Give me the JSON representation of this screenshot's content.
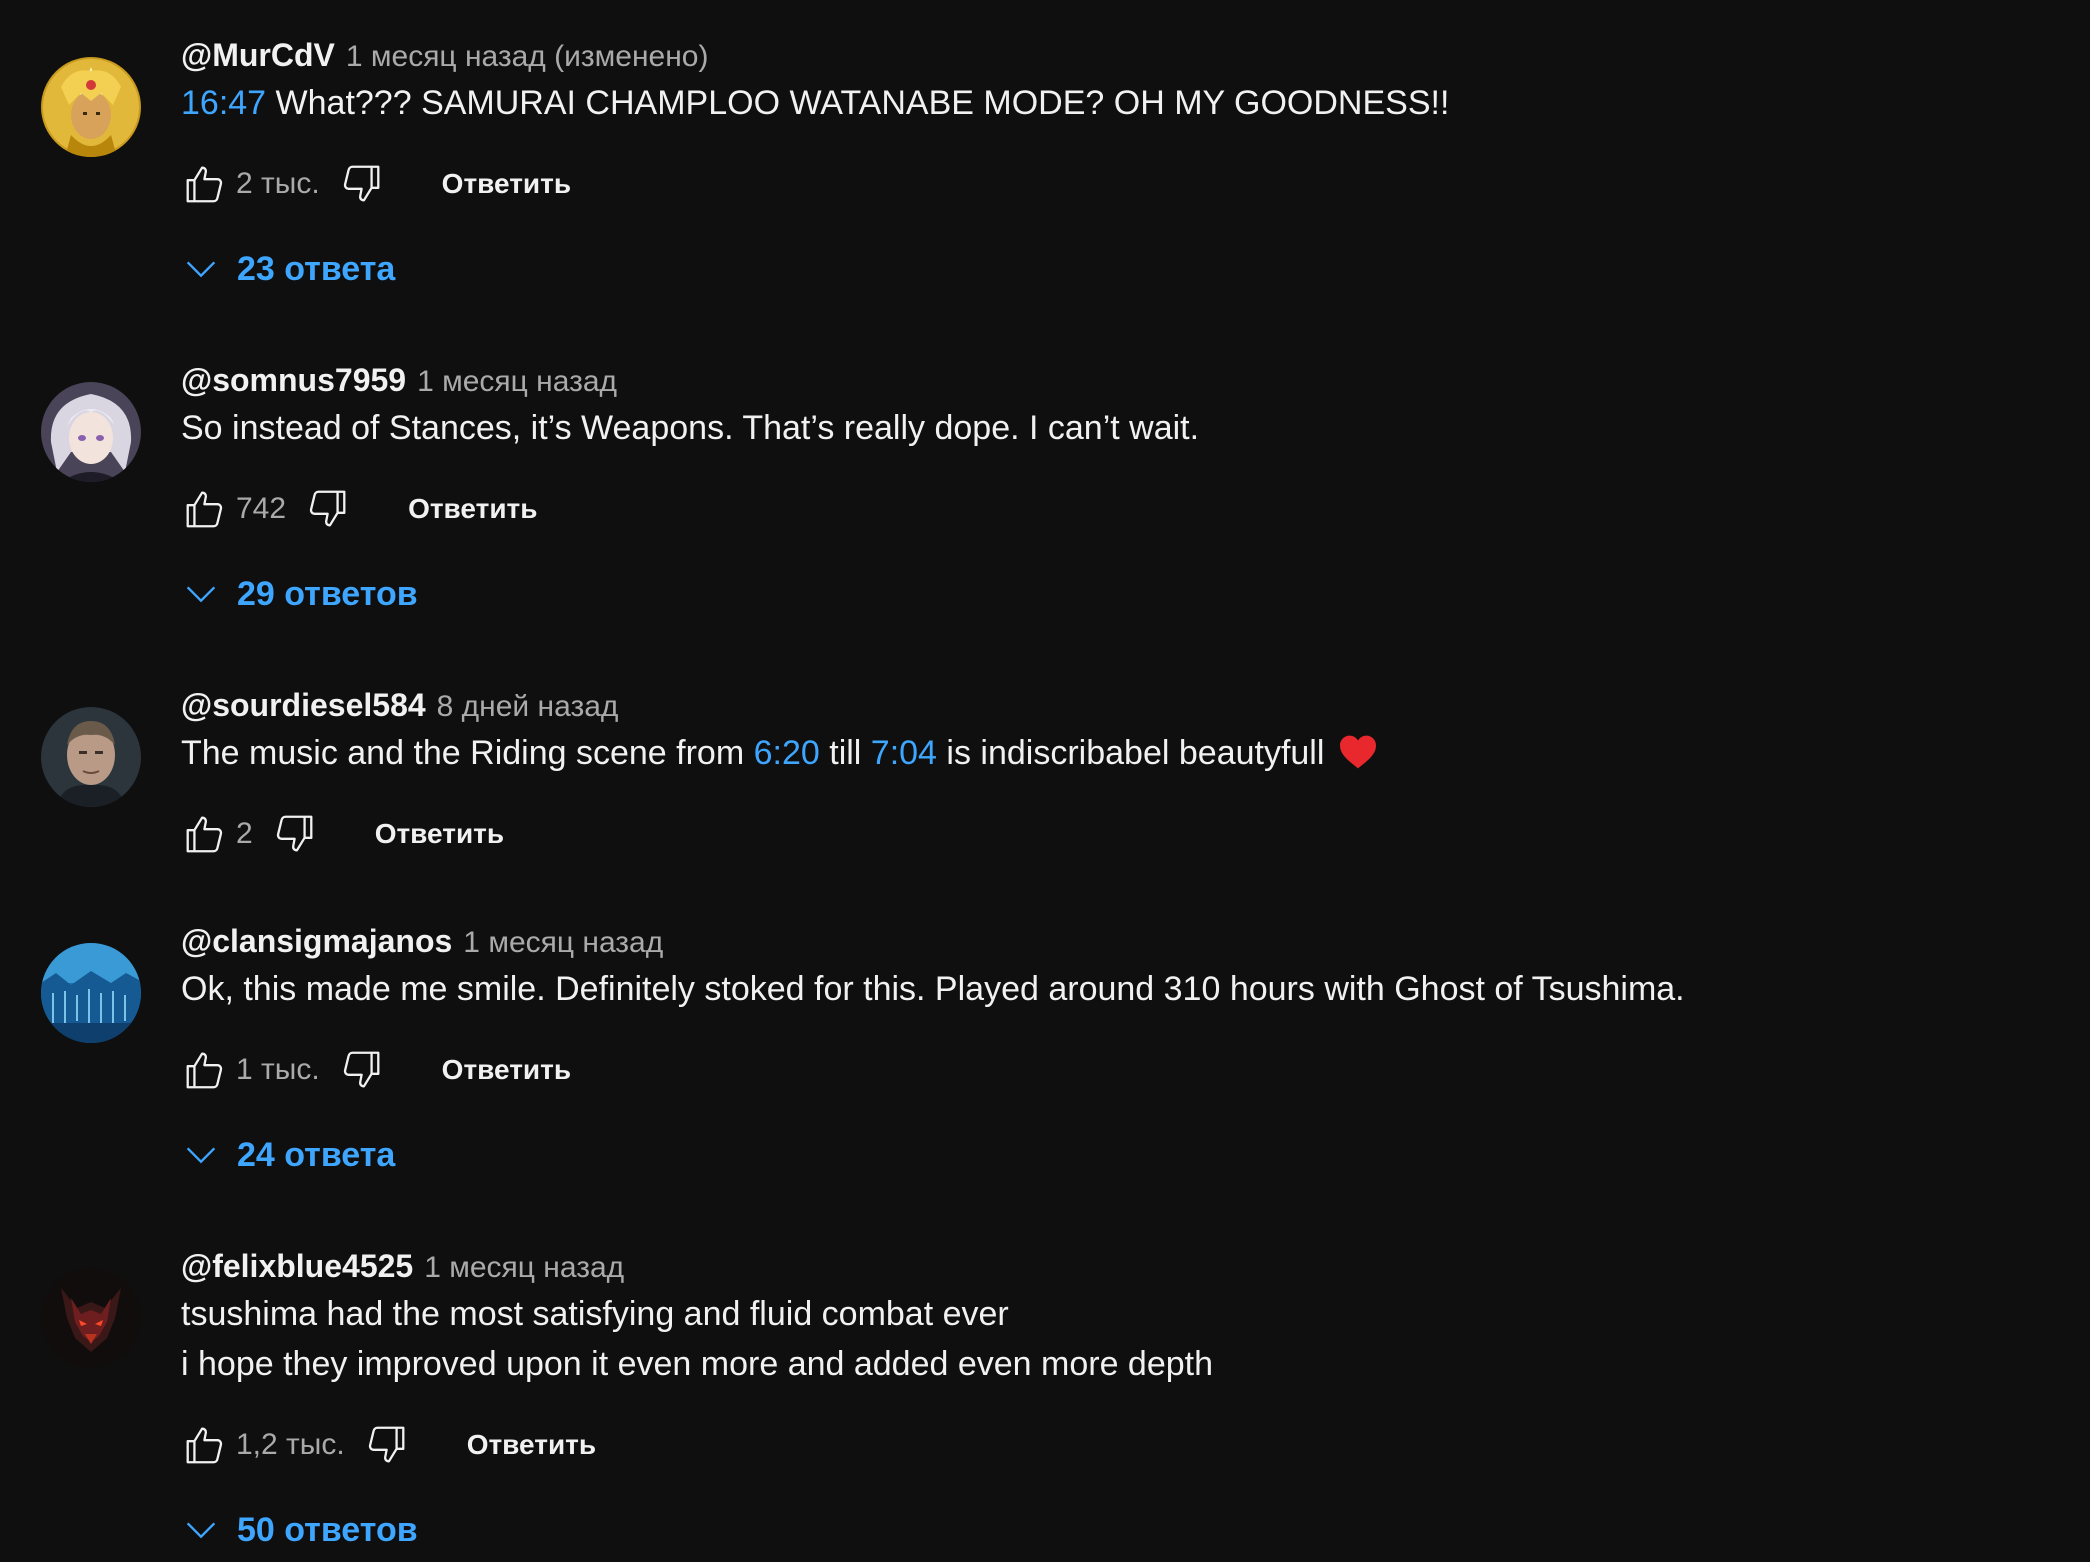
{
  "colors": {
    "background": "#0f0f0f",
    "text_primary": "#f1f1f1",
    "text_secondary": "#aaaaaa",
    "link": "#3ea6ff"
  },
  "comments": [
    {
      "author": "@MurCdV",
      "time": "1 месяц назад (изменено)",
      "text_parts": [
        {
          "text": "16:47",
          "timestamp": true
        },
        {
          "text": " What??? SAMURAI CHAMPLOO WATANABE MODE? OH MY GOODNESS!!",
          "timestamp": false
        }
      ],
      "likes": "2 тыс.",
      "reply_label": "Ответить",
      "replies_label": "23 ответа",
      "avatar_icon": "golden-warrior-avatar"
    },
    {
      "author": "@somnus7959",
      "time": "1 месяц назад",
      "text_parts": [
        {
          "text": "So instead of Stances, it’s Weapons. That’s really dope. I can’t wait.",
          "timestamp": false
        }
      ],
      "likes": "742",
      "reply_label": "Ответить",
      "replies_label": "29 ответов",
      "avatar_icon": "silver-hair-anime-avatar"
    },
    {
      "author": "@sourdiesel584",
      "time": "8 дней назад",
      "text_parts": [
        {
          "text": "The music and the Riding scene from ",
          "timestamp": false
        },
        {
          "text": "6:20",
          "timestamp": true
        },
        {
          "text": " till ",
          "timestamp": false
        },
        {
          "text": "7:04",
          "timestamp": true
        },
        {
          "text": " is indiscribabel beautyfull",
          "timestamp": false
        }
      ],
      "emoji": "heart-emoji",
      "likes": "2",
      "reply_label": "Ответить",
      "replies_label": "",
      "avatar_icon": "man-portrait-avatar"
    },
    {
      "author": "@clansigmajanos",
      "time": "1 месяц назад",
      "text_parts": [
        {
          "text": "Ok, this made me smile. Definitely stoked for this. Played around 310 hours with Ghost of Tsushima.",
          "timestamp": false
        }
      ],
      "likes": "1 тыс.",
      "reply_label": "Ответить",
      "replies_label": "24 ответа",
      "avatar_icon": "blue-landscape-avatar"
    },
    {
      "author": "@felixblue4525",
      "time": "1 месяц назад",
      "text_parts": [
        {
          "text": "tsushima had the most satisfying and fluid combat ever",
          "timestamp": false,
          "newline_after": true
        },
        {
          "text": "i hope they improved upon it even more and added even more depth",
          "timestamp": false
        }
      ],
      "likes": "1,2 тыс.",
      "reply_label": "Ответить",
      "replies_label": "50 ответов",
      "avatar_icon": "red-demon-avatar"
    }
  ]
}
